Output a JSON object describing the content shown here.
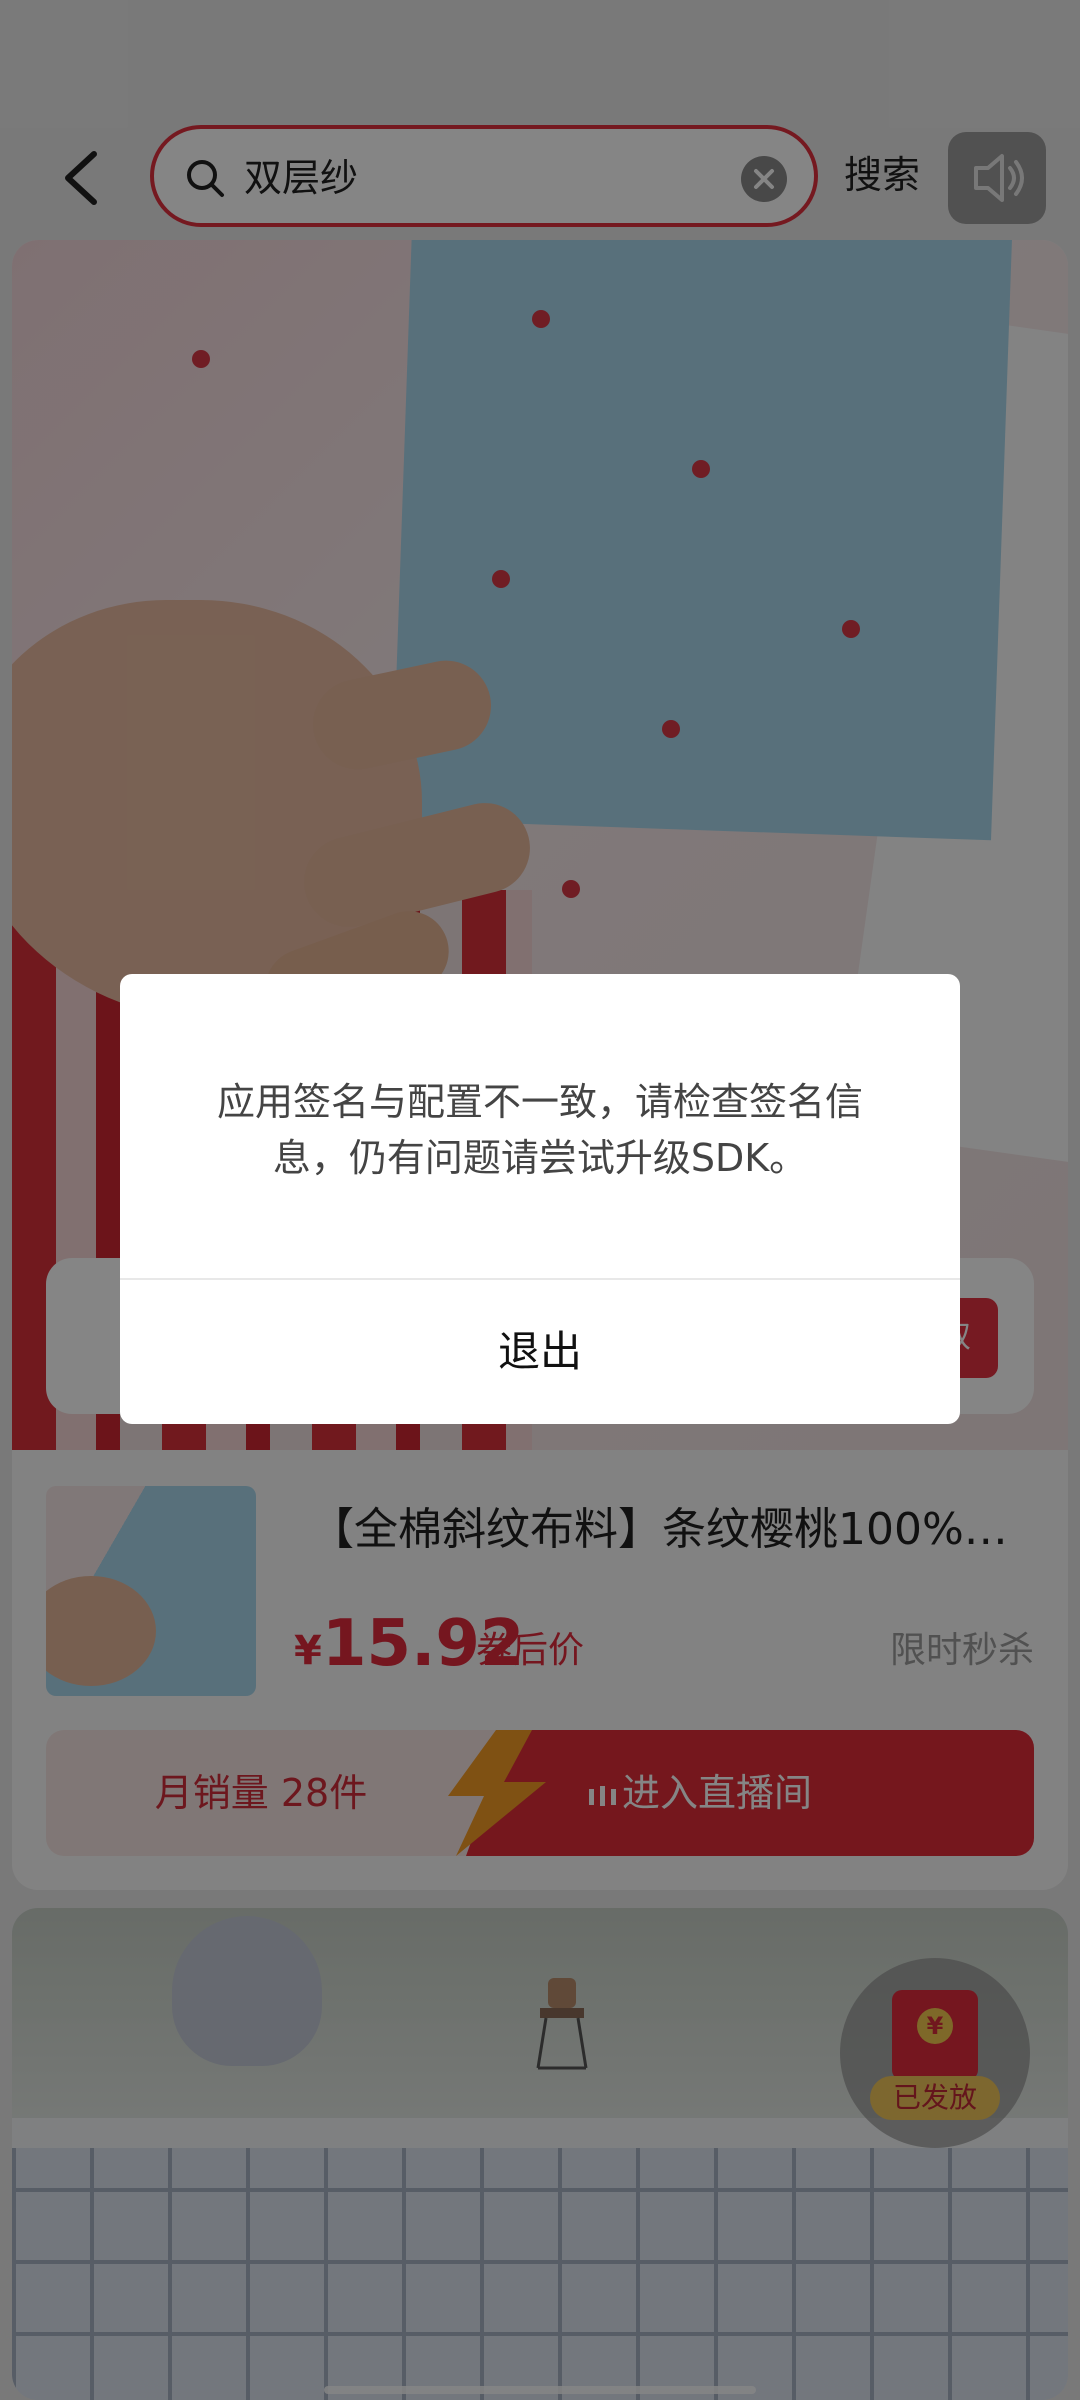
{
  "search": {
    "query": "双层纱",
    "button_label": "搜索"
  },
  "product": {
    "title": "【全棉斜纹布料】条纹樱桃100%…",
    "currency": "¥",
    "price": "15.92",
    "price_tag": "券后价",
    "promo": "限时秒杀",
    "monthly_sales": "月销量 28件",
    "live_button": "进入直播间",
    "hero_button_partial": "双"
  },
  "red_packet": {
    "label": "已发放",
    "coin_symbol": "¥"
  },
  "dialog": {
    "message": "应用签名与配置不一致，请检查签名信息，仍有问题请尝试升级SDK。",
    "button": "退出"
  },
  "icons": [
    "back-icon",
    "search-icon",
    "clear-icon",
    "speaker-icon",
    "live-bars-icon"
  ],
  "colors": {
    "accent": "#e02b3d",
    "overlay": "rgba(0,0,0,0.48)"
  }
}
